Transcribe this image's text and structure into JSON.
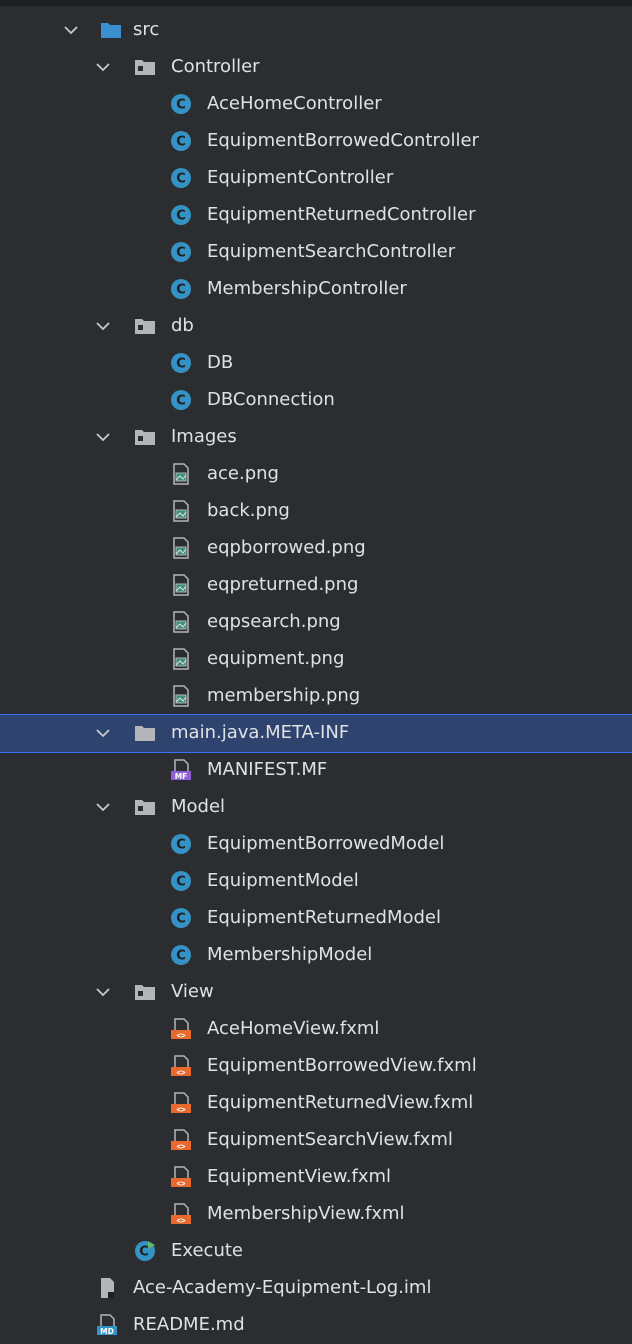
{
  "tree": {
    "root": {
      "label": "src",
      "icon": "source-folder-icon"
    },
    "rows": [
      {
        "label": "Controller",
        "icon": "package-folder-icon",
        "level": 1,
        "kind": "folder"
      },
      {
        "label": "AceHomeController",
        "icon": "java-class-icon",
        "level": 2,
        "kind": "class"
      },
      {
        "label": "EquipmentBorrowedController",
        "icon": "java-class-icon",
        "level": 2,
        "kind": "class"
      },
      {
        "label": "EquipmentController",
        "icon": "java-class-icon",
        "level": 2,
        "kind": "class"
      },
      {
        "label": "EquipmentReturnedController",
        "icon": "java-class-icon",
        "level": 2,
        "kind": "class"
      },
      {
        "label": "EquipmentSearchController",
        "icon": "java-class-icon",
        "level": 2,
        "kind": "class"
      },
      {
        "label": "MembershipController",
        "icon": "java-class-icon",
        "level": 2,
        "kind": "class"
      },
      {
        "label": "db",
        "icon": "package-folder-icon",
        "level": 1,
        "kind": "folder"
      },
      {
        "label": "DB",
        "icon": "java-class-icon",
        "level": 2,
        "kind": "class"
      },
      {
        "label": "DBConnection",
        "icon": "java-class-icon",
        "level": 2,
        "kind": "class"
      },
      {
        "label": "Images",
        "icon": "package-folder-icon",
        "level": 1,
        "kind": "folder"
      },
      {
        "label": "ace.png",
        "icon": "image-file-icon",
        "level": 2,
        "kind": "image"
      },
      {
        "label": "back.png",
        "icon": "image-file-icon",
        "level": 2,
        "kind": "image"
      },
      {
        "label": "eqpborrowed.png",
        "icon": "image-file-icon",
        "level": 2,
        "kind": "image"
      },
      {
        "label": "eqpreturned.png",
        "icon": "image-file-icon",
        "level": 2,
        "kind": "image"
      },
      {
        "label": "eqpsearch.png",
        "icon": "image-file-icon",
        "level": 2,
        "kind": "image"
      },
      {
        "label": "equipment.png",
        "icon": "image-file-icon",
        "level": 2,
        "kind": "image"
      },
      {
        "label": "membership.png",
        "icon": "image-file-icon",
        "level": 2,
        "kind": "image"
      },
      {
        "label": "main.java.META-INF",
        "icon": "plain-folder-icon",
        "level": 1,
        "kind": "folder-plain",
        "selected": true
      },
      {
        "label": "MANIFEST.MF",
        "icon": "manifest-file-icon",
        "level": 2,
        "kind": "manifest"
      },
      {
        "label": "Model",
        "icon": "package-folder-icon",
        "level": 1,
        "kind": "folder"
      },
      {
        "label": "EquipmentBorrowedModel",
        "icon": "java-class-icon",
        "level": 2,
        "kind": "class"
      },
      {
        "label": "EquipmentModel",
        "icon": "java-class-icon",
        "level": 2,
        "kind": "class"
      },
      {
        "label": "EquipmentReturnedModel",
        "icon": "java-class-icon",
        "level": 2,
        "kind": "class"
      },
      {
        "label": "MembershipModel",
        "icon": "java-class-icon",
        "level": 2,
        "kind": "class"
      },
      {
        "label": "View",
        "icon": "package-folder-icon",
        "level": 1,
        "kind": "folder"
      },
      {
        "label": "AceHomeView.fxml",
        "icon": "fxml-file-icon",
        "level": 2,
        "kind": "fxml"
      },
      {
        "label": "EquipmentBorrowedView.fxml",
        "icon": "fxml-file-icon",
        "level": 2,
        "kind": "fxml"
      },
      {
        "label": "EquipmentReturnedView.fxml",
        "icon": "fxml-file-icon",
        "level": 2,
        "kind": "fxml"
      },
      {
        "label": "EquipmentSearchView.fxml",
        "icon": "fxml-file-icon",
        "level": 2,
        "kind": "fxml"
      },
      {
        "label": "EquipmentView.fxml",
        "icon": "fxml-file-icon",
        "level": 2,
        "kind": "fxml"
      },
      {
        "label": "MembershipView.fxml",
        "icon": "fxml-file-icon",
        "level": 2,
        "kind": "fxml"
      },
      {
        "label": "Execute",
        "icon": "runnable-class-icon",
        "level": 1,
        "kind": "runnable"
      },
      {
        "label": "Ace-Academy-Equipment-Log.iml",
        "icon": "iml-file-icon",
        "level": 0,
        "kind": "iml"
      },
      {
        "label": "README.md",
        "icon": "markdown-file-icon",
        "level": 0,
        "kind": "markdown"
      }
    ]
  },
  "colors": {
    "background": "#2b2d30",
    "selection": "#2e436e",
    "selection_border": "#3574f0",
    "text": "#dfe1e5",
    "class_icon": "#3592c4",
    "runnable_badge": "#5fb865",
    "fxml_icon": "#e8692c",
    "manifest_badge": "#8f5fd6",
    "markdown_badge": "#3592c4",
    "source_folder": "#3a8fd0",
    "package_folder": "#b3b5ba"
  },
  "icon_labels": {
    "class_letter": "C",
    "manifest_badge": "MF",
    "markdown_badge": "MD",
    "fxml_badge": "<>"
  }
}
